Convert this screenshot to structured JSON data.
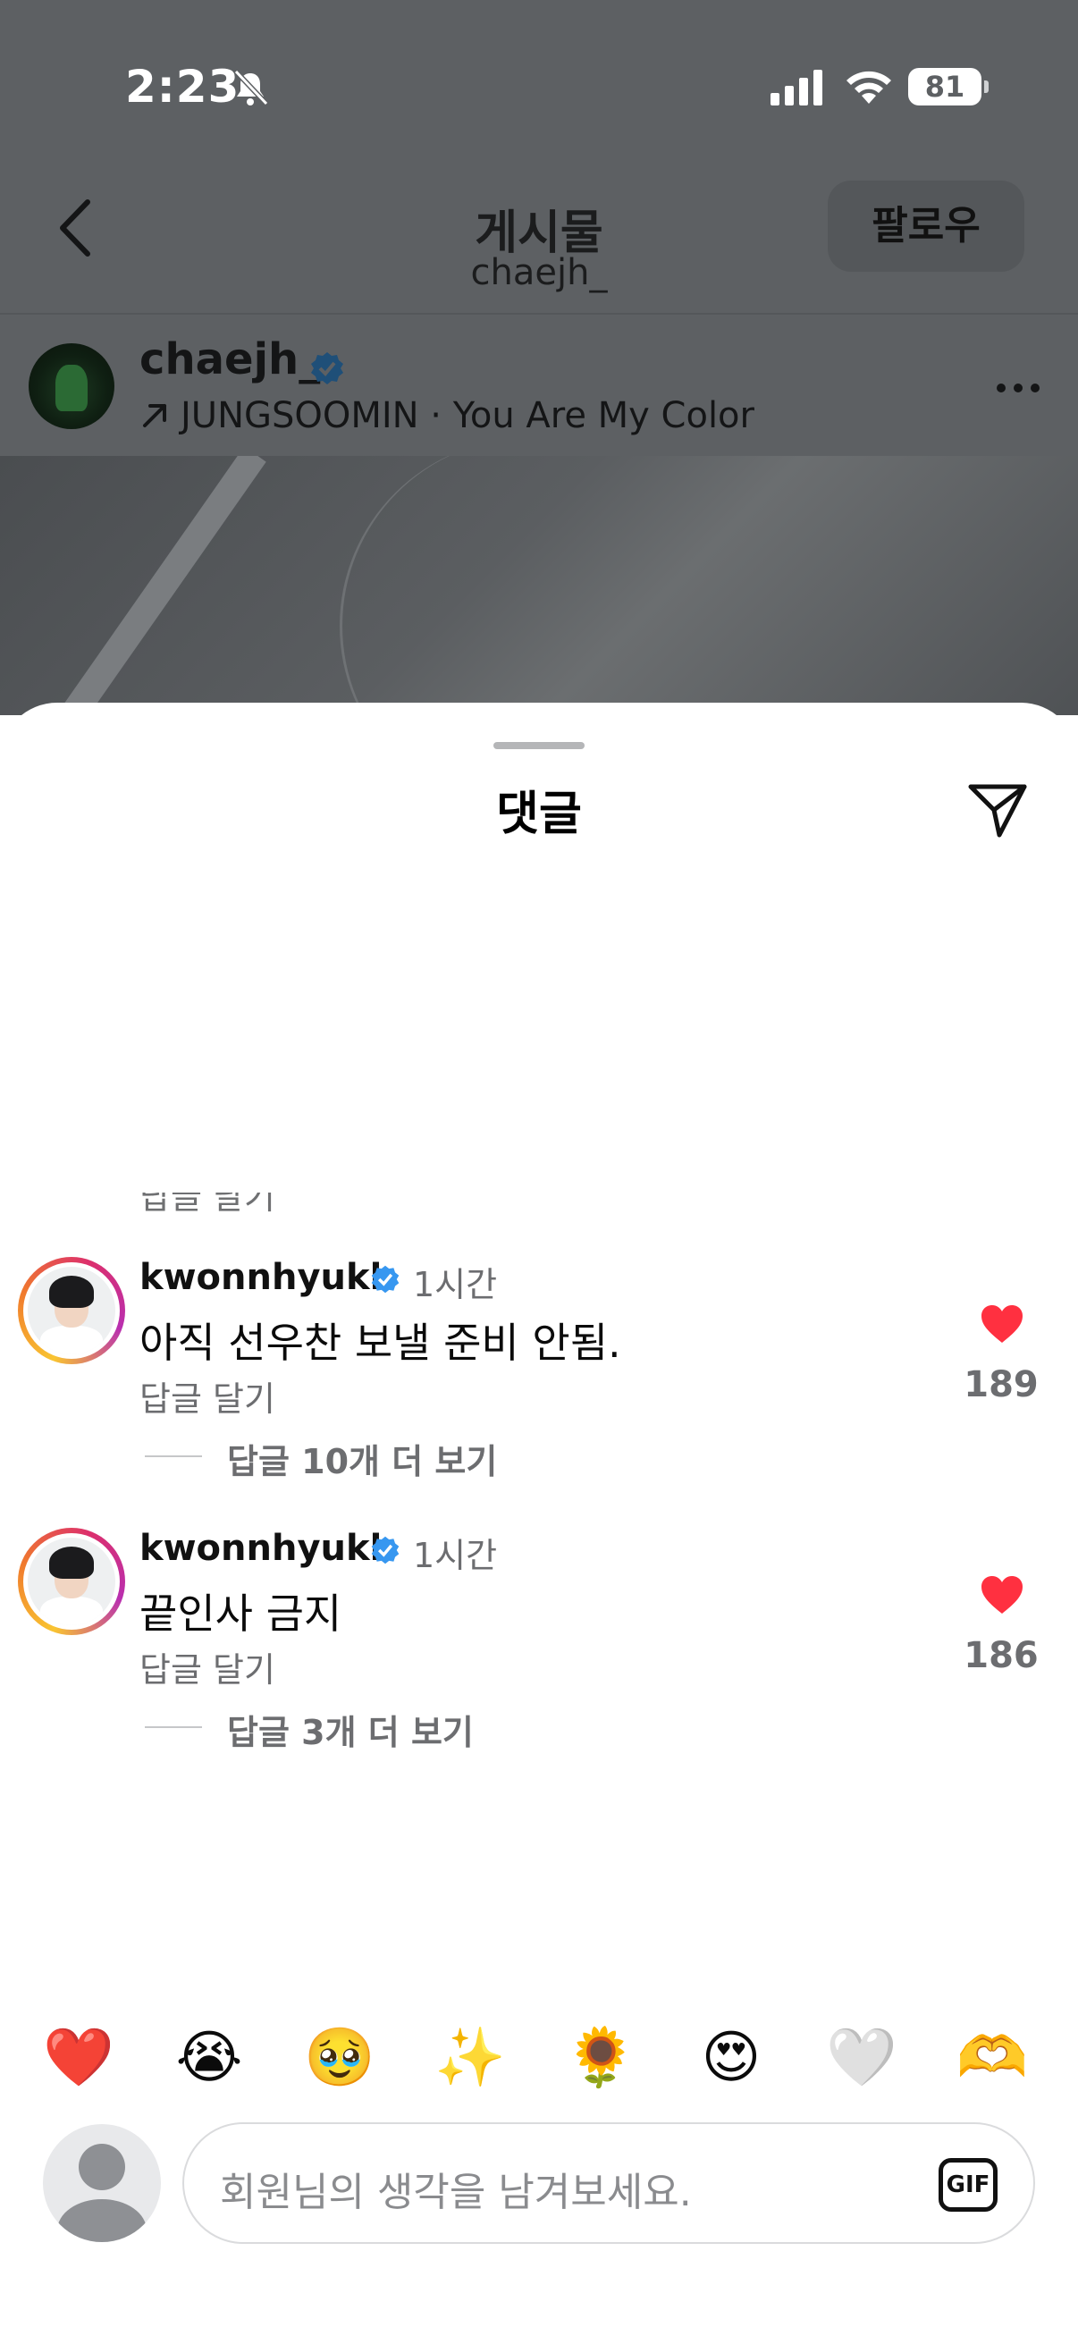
{
  "status_bar": {
    "time": "2:23",
    "battery": "81"
  },
  "nav": {
    "title": "게시물",
    "subtitle": "chaejh_",
    "follow_label": "팔로우"
  },
  "post": {
    "username": "chaejh_",
    "music": "JUNGSOOMIN · You Are My Color"
  },
  "sheet": {
    "title": "댓글",
    "faded_reply": "답글 달기"
  },
  "comments": [
    {
      "username": "kwonnhyukk",
      "time": "1시간",
      "text": "아직 선우찬 보낼 준비 안됨.",
      "reply_label": "답글 달기",
      "more_replies": "답글 10개 더 보기",
      "likes": "189"
    },
    {
      "username": "kwonnhyukk",
      "time": "1시간",
      "text": "끝인사 금지",
      "reply_label": "답글 달기",
      "more_replies": "답글 3개 더 보기",
      "likes": "186"
    }
  ],
  "emoji_bar": [
    "❤️",
    "😭",
    "🥹",
    "✨",
    "🌻",
    "😍",
    "🤍",
    "🫶"
  ],
  "input": {
    "placeholder": "회원님의 생각을 남겨보세요.",
    "gif_label": "GIF"
  },
  "colors": {
    "like": "#ff3040",
    "verified": "#3797f0",
    "dim_overlay": "#5d6063"
  },
  "icons": [
    "back-icon",
    "verified-icon",
    "arrow-up-right-icon",
    "more-icon",
    "send-icon",
    "heart-icon",
    "gif-icon",
    "bell-off-icon",
    "signal-icon",
    "wifi-icon"
  ]
}
